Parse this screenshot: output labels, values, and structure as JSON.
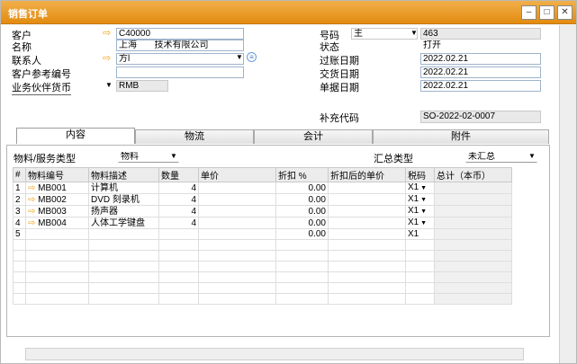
{
  "window": {
    "title": "销售订单",
    "minimize": "–",
    "maximize": "□",
    "close": "✕"
  },
  "header": {
    "customer_label": "客户",
    "customer_value": "C40000",
    "name_label": "名称",
    "name_value_a": "上海",
    "name_value_b": "技术有限公司",
    "contact_label": "联系人",
    "contact_value": "方l",
    "ref_label": "客户参考编号",
    "ref_value": "",
    "currency_label": "业务伙伴货币",
    "currency_value": "RMB",
    "number_label": "号码",
    "series_value": "主",
    "number_value": "463",
    "status_label": "状态",
    "status_value": "打开",
    "posting_label": "过账日期",
    "posting_value": "2022.02.21",
    "delivery_label": "交货日期",
    "delivery_value": "2022.02.21",
    "doc_label": "单据日期",
    "doc_value": "2022.02.21",
    "extra_label": "补充代码",
    "extra_value": "SO-2022-02-0007"
  },
  "tabs": [
    {
      "label": "内容"
    },
    {
      "label": "物流"
    },
    {
      "label": "会计"
    },
    {
      "label": "附件"
    }
  ],
  "filters": {
    "type_label": "物料/服务类型",
    "type_value": "物料",
    "summary_label": "汇总类型",
    "summary_value": "未汇总"
  },
  "table": {
    "headers": [
      "#",
      "物料编号",
      "物料描述",
      "数量",
      "单价",
      "折扣 %",
      "折扣后的单价",
      "税码",
      "总计（本币）"
    ],
    "rows": [
      {
        "no": "1",
        "code": "MB001",
        "desc": "计算机",
        "qty": "4",
        "price": "",
        "disc": "0.00",
        "after": "",
        "tax": "X1"
      },
      {
        "no": "2",
        "code": "MB002",
        "desc": "DVD 刻录机",
        "qty": "4",
        "price": "",
        "disc": "0.00",
        "after": "",
        "tax": "X1"
      },
      {
        "no": "3",
        "code": "MB003",
        "desc": "扬声器",
        "qty": "4",
        "price": "",
        "disc": "0.00",
        "after": "",
        "tax": "X1"
      },
      {
        "no": "4",
        "code": "MB004",
        "desc": "人体工学键盘",
        "qty": "4",
        "price": "",
        "disc": "0.00",
        "after": "",
        "tax": "X1"
      },
      {
        "no": "5",
        "code": "",
        "desc": "",
        "qty": "",
        "price": "",
        "disc": "0.00",
        "after": "",
        "tax": "X1"
      }
    ]
  }
}
